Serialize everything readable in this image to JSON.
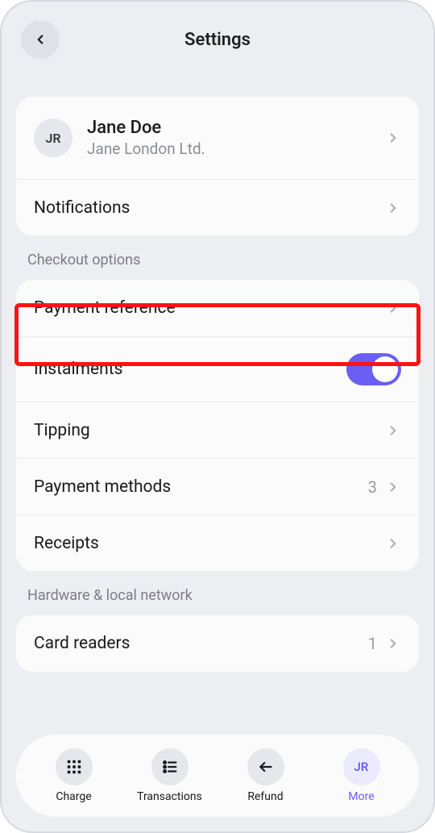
{
  "header": {
    "title": "Settings"
  },
  "profile": {
    "initials": "JR",
    "name": "Jane Doe",
    "subtitle": "Jane London Ltd."
  },
  "rows": {
    "notifications": "Notifications"
  },
  "checkout": {
    "label": "Checkout options",
    "payment_reference": "Payment reference",
    "instalments": "Instalments",
    "tipping": "Tipping",
    "payment_methods": "Payment methods",
    "payment_methods_count": "3",
    "receipts": "Receipts"
  },
  "hardware": {
    "label": "Hardware & local network",
    "card_readers": "Card readers",
    "card_readers_count": "1"
  },
  "nav": {
    "charge": "Charge",
    "transactions": "Transactions",
    "refund": "Refund",
    "more": "More",
    "more_initials": "JR"
  },
  "colors": {
    "accent": "#6a5ef5",
    "highlight": "#ff1212"
  }
}
